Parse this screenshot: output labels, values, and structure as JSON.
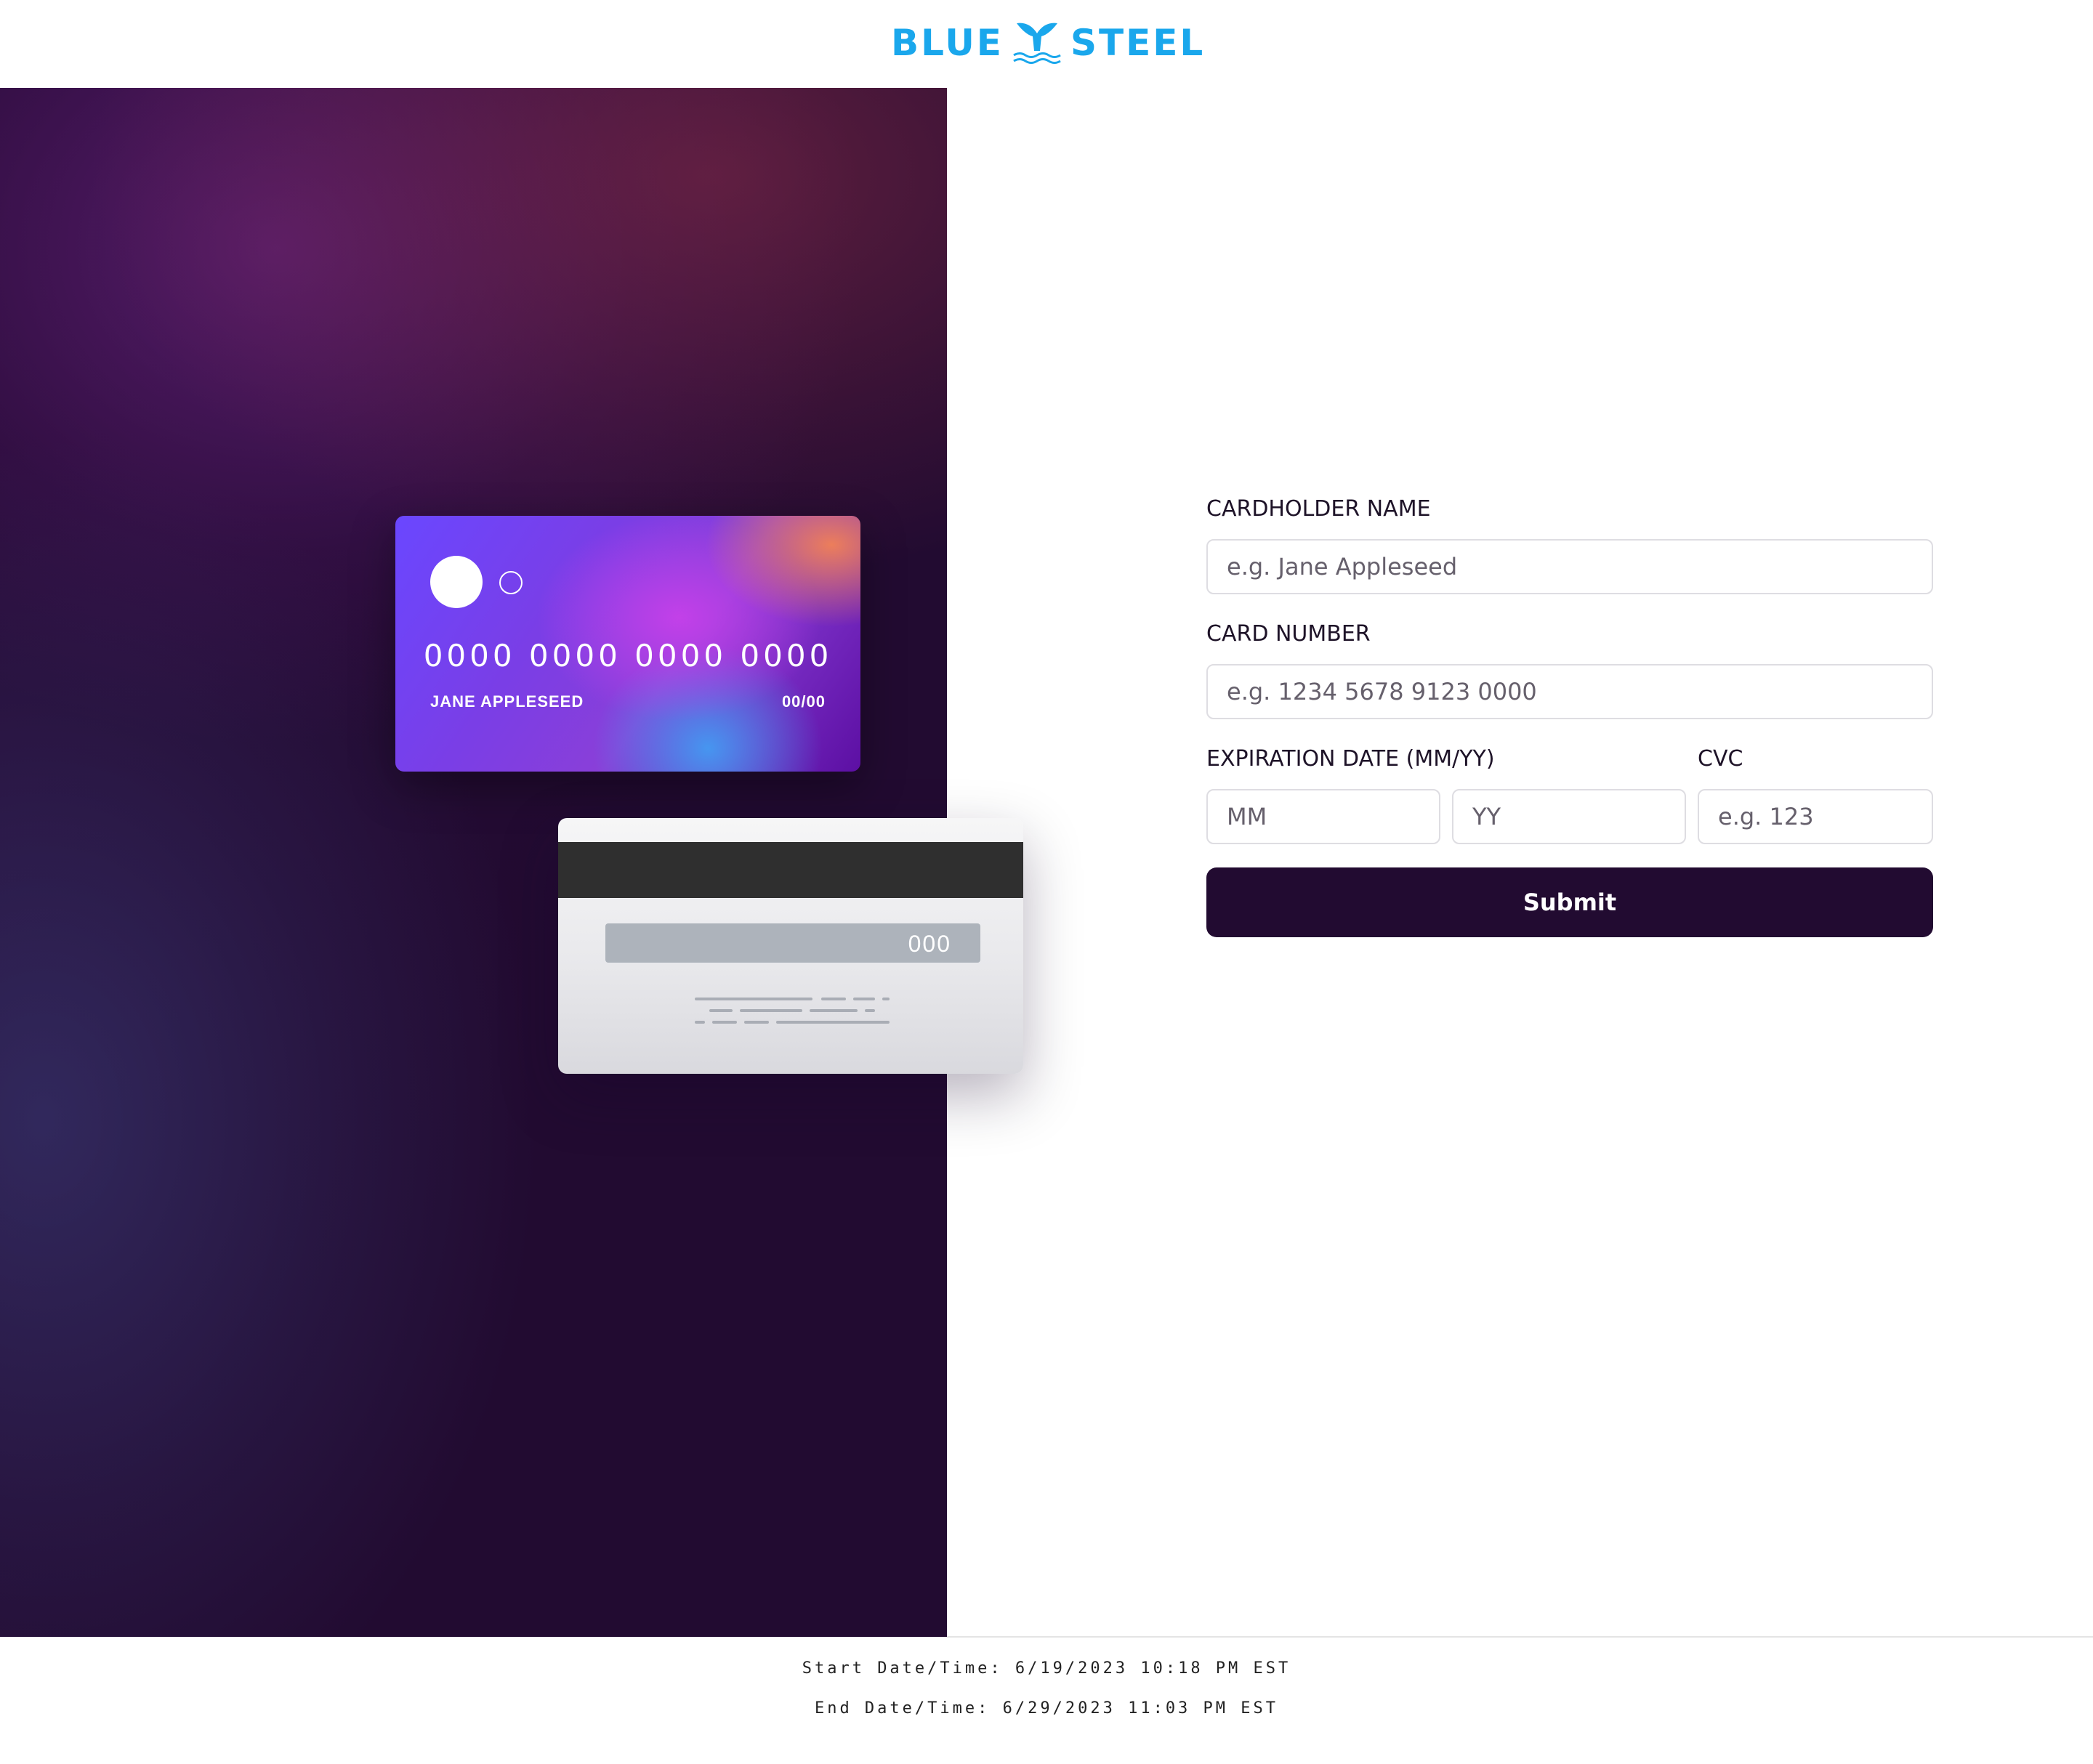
{
  "header": {
    "brand_left": "BLUE",
    "brand_right": "STEEL",
    "logo_icon": "whale-tail-icon",
    "brand_color": "#1aa7ec"
  },
  "card_front": {
    "number": "0000 0000 0000 0000",
    "name": "JANE APPLESEED",
    "expiry": "00/00"
  },
  "card_back": {
    "cvc": "000"
  },
  "form": {
    "cardholder_label": "CARDHOLDER NAME",
    "cardholder_placeholder": "e.g. Jane Appleseed",
    "number_label": "CARD NUMBER",
    "number_placeholder": "e.g. 1234 5678 9123 0000",
    "expiry_label": "EXPIRATION DATE (MM/YY)",
    "mm_placeholder": "MM",
    "yy_placeholder": "YY",
    "cvc_label": "CVC",
    "cvc_placeholder": "e.g. 123",
    "submit_label": "Submit"
  },
  "footer": {
    "start": "Start Date/Time: 6/19/2023 10:18 PM EST",
    "end": "End Date/Time: 6/29/2023 11:03 PM EST"
  },
  "colors": {
    "dark": "#220b31",
    "border": "#dedde2"
  }
}
